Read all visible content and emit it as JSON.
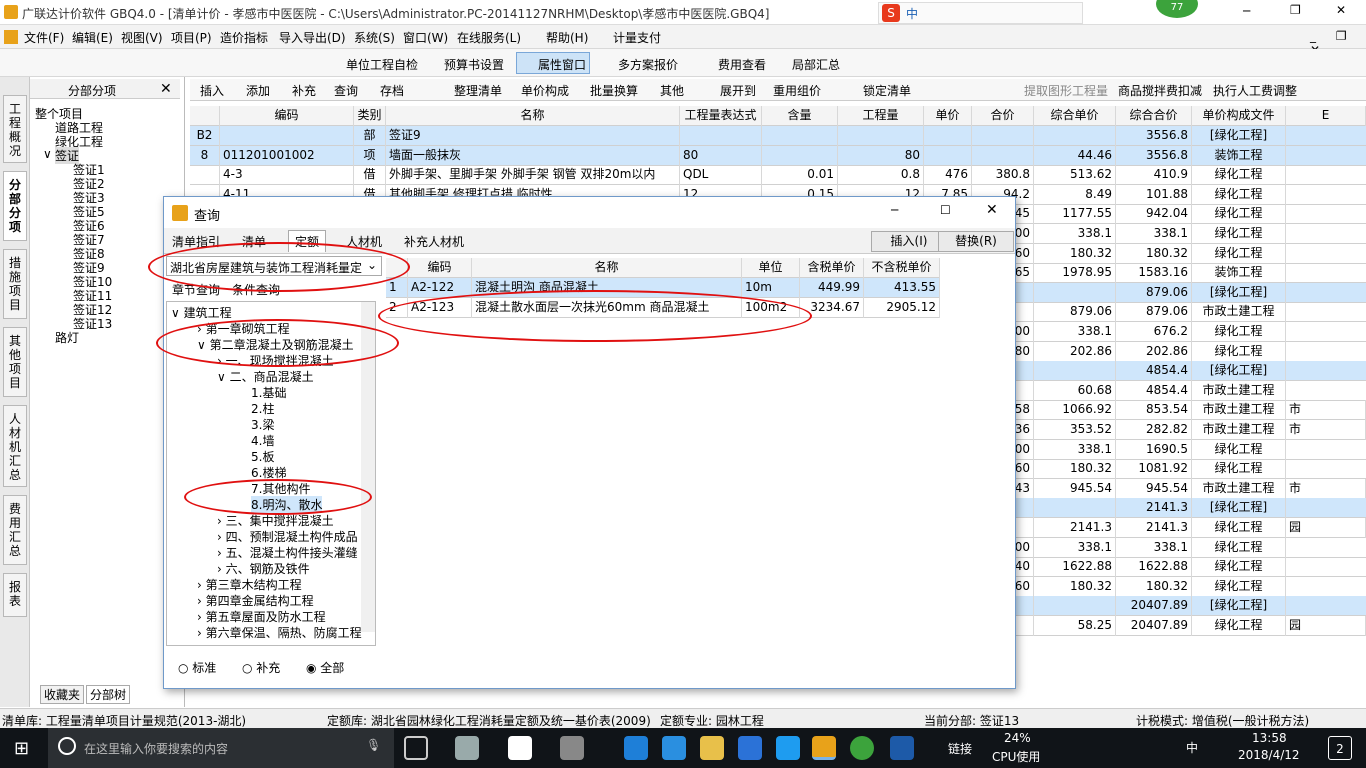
{
  "window": {
    "title": "广联达计价软件 GBQ4.0 - [清单计价 - 孝感市中医医院 - C:\\Users\\Administrator.PC-20141127NRHM\\Desktop\\孝感市中医医院.GBQ4]",
    "badge": "77",
    "ime": "中"
  },
  "menu": [
    "文件(F)",
    "编辑(E)",
    "视图(V)",
    "项目(P)",
    "造价指标",
    "导入导出(D)",
    "系统(S)",
    "窗口(W)",
    "在线服务(L)",
    "帮助(H)",
    "计量支付"
  ],
  "toolbar1": {
    "self_check": "单位工程自检",
    "budget_settings": "预算书设置",
    "properties": "属性窗口",
    "multi_plan": "多方案报价",
    "fee_view": "费用查看",
    "partial_summary": "局部汇总"
  },
  "left_tabs": [
    "工程概况",
    "分部分项",
    "措施项目",
    "其他项目",
    "人材机汇总",
    "费用汇总",
    "报表"
  ],
  "nav": {
    "header": "分部分项",
    "close": "✕",
    "items": [
      "整个项目",
      "道路工程",
      "绿化工程",
      "签证",
      "签证1",
      "签证2",
      "签证3",
      "签证5",
      "签证6",
      "签证7",
      "签证8",
      "签证9",
      "签证10",
      "签证11",
      "签证12",
      "签证13",
      "路灯"
    ],
    "bottom_tabs": [
      "收藏夹",
      "分部树"
    ]
  },
  "toolbar2": [
    "插入",
    "添加",
    "补充",
    "查询",
    "存档",
    "整理清单",
    "单价构成",
    "批量换算",
    "其他",
    "展开到",
    "重用组价",
    "锁定清单",
    "提取图形工程量",
    "商品搅拌费扣减",
    "执行人工费调整"
  ],
  "grid": {
    "headers": [
      "编码",
      "类别",
      "名称",
      "工程量表达式",
      "含量",
      "工程量",
      "单价",
      "合价",
      "综合单价",
      "综合合价",
      "单价构成文件",
      "E"
    ],
    "rows": [
      {
        "n": "B2",
        "code": "",
        "cat": "部",
        "name": "签证9",
        "expr": "",
        "qty_r": "",
        "qty": "",
        "price": "",
        "total": "",
        "cu": "",
        "ct": "3556.8",
        "file": "[绿化工程]"
      },
      {
        "n": "8",
        "code": "011201001002",
        "cat": "项",
        "name": "墙面一般抹灰",
        "expr": "80",
        "qty_r": "",
        "qty": "80",
        "price": "",
        "total": "",
        "cu": "44.46",
        "ct": "3556.8",
        "file": "装饰工程"
      },
      {
        "n": "",
        "code": "4-3",
        "cat": "借",
        "name": "外脚手架、里脚手架 外脚手架 钢管 双排20m以内",
        "expr": "QDL",
        "qty_r": "0.01",
        "qty": "0.8",
        "price": "476",
        "total": "380.8",
        "cu": "513.62",
        "ct": "410.9",
        "file": "绿化工程"
      },
      {
        "n": "",
        "code": "4-11",
        "cat": "借",
        "name": "其他脚手架 修理打点措 临时性",
        "expr": "12",
        "qty_r": "0.15",
        "qty": "12",
        "price": "7.85",
        "total": "94.2",
        "cu": "8.49",
        "ct": "101.88",
        "file": "绿化工程"
      },
      {
        "n": "",
        "code": "",
        "cat": "",
        "name": "",
        "expr": "",
        "qty_r": "",
        "qty": "",
        "price": "",
        "total": "66.45",
        "cu": "1177.55",
        "ct": "942.04",
        "file": "绿化工程"
      },
      {
        "n": "",
        "code": "",
        "cat": "",
        "name": "",
        "expr": "",
        "qty_r": "",
        "qty": "",
        "price": "",
        "total": "300",
        "cu": "338.1",
        "ct": "338.1",
        "file": "绿化工程"
      },
      {
        "n": "",
        "code": "",
        "cat": "",
        "name": "",
        "expr": "",
        "qty_r": "",
        "qty": "",
        "price": "",
        "total": "160",
        "cu": "180.32",
        "ct": "180.32",
        "file": "绿化工程"
      },
      {
        "n": "",
        "code": "",
        "cat": "",
        "name": "",
        "expr": "",
        "qty_r": "",
        "qty": "",
        "price": "",
        "total": "20.65",
        "cu": "1978.95",
        "ct": "1583.16",
        "file": "装饰工程"
      },
      {
        "n": "",
        "code": "",
        "cat": "",
        "name": "",
        "expr": "",
        "qty_r": "",
        "qty": "",
        "price": "",
        "total": "",
        "cu": "",
        "ct": "879.06",
        "file": "[绿化工程]"
      },
      {
        "n": "",
        "code": "",
        "cat": "",
        "name": "",
        "expr": "",
        "qty_r": "",
        "qty": "",
        "price": "",
        "total": "",
        "cu": "879.06",
        "ct": "879.06",
        "file": "市政土建工程"
      },
      {
        "n": "",
        "code": "",
        "cat": "",
        "name": "",
        "expr": "",
        "qty_r": "",
        "qty": "",
        "price": "",
        "total": "600",
        "cu": "338.1",
        "ct": "676.2",
        "file": "绿化工程"
      },
      {
        "n": "",
        "code": "",
        "cat": "",
        "name": "",
        "expr": "",
        "qty_r": "",
        "qty": "",
        "price": "",
        "total": "180",
        "cu": "202.86",
        "ct": "202.86",
        "file": "绿化工程"
      },
      {
        "n": "",
        "code": "",
        "cat": "",
        "name": "",
        "expr": "",
        "qty_r": "",
        "qty": "",
        "price": "",
        "total": "",
        "cu": "",
        "ct": "4854.4",
        "file": "[绿化工程]"
      },
      {
        "n": "",
        "code": "",
        "cat": "",
        "name": "",
        "expr": "",
        "qty_r": "",
        "qty": "",
        "price": "",
        "total": "",
        "cu": "60.68",
        "ct": "4854.4",
        "file": "市政土建工程"
      },
      {
        "n": "",
        "code": "",
        "cat": "",
        "name": "",
        "expr": "",
        "qty_r": "",
        "qty": "",
        "price": "",
        "total": "3.58",
        "cu": "1066.92",
        "ct": "853.54",
        "file": "市政土建工程",
        "e": "市"
      },
      {
        "n": "",
        "code": "",
        "cat": "",
        "name": "",
        "expr": "",
        "qty_r": "",
        "qty": "",
        "price": "",
        "total": "36.36",
        "cu": "353.52",
        "ct": "282.82",
        "file": "市政土建工程",
        "e": "市"
      },
      {
        "n": "",
        "code": "",
        "cat": "",
        "name": "",
        "expr": "",
        "qty_r": "",
        "qty": "",
        "price": "",
        "total": "1500",
        "cu": "338.1",
        "ct": "1690.5",
        "file": "绿化工程"
      },
      {
        "n": "",
        "code": "",
        "cat": "",
        "name": "",
        "expr": "",
        "qty_r": "",
        "qty": "",
        "price": "",
        "total": "960",
        "cu": "180.32",
        "ct": "1081.92",
        "file": "绿化工程"
      },
      {
        "n": "",
        "code": "",
        "cat": "",
        "name": "",
        "expr": "",
        "qty_r": "",
        "qty": "",
        "price": "",
        "total": "52.43",
        "cu": "945.54",
        "ct": "945.54",
        "file": "市政土建工程",
        "e": "市"
      },
      {
        "n": "",
        "code": "",
        "cat": "",
        "name": "",
        "expr": "",
        "qty_r": "",
        "qty": "",
        "price": "",
        "total": "",
        "cu": "",
        "ct": "2141.3",
        "file": "[绿化工程]"
      },
      {
        "n": "",
        "code": "",
        "cat": "",
        "name": "",
        "expr": "",
        "qty_r": "",
        "qty": "",
        "price": "",
        "total": "",
        "cu": "2141.3",
        "ct": "2141.3",
        "file": "绿化工程",
        "e": "园"
      },
      {
        "n": "",
        "code": "",
        "cat": "",
        "name": "",
        "expr": "",
        "qty_r": "",
        "qty": "",
        "price": "",
        "total": "300",
        "cu": "338.1",
        "ct": "338.1",
        "file": "绿化工程"
      },
      {
        "n": "",
        "code": "",
        "cat": "",
        "name": "",
        "expr": "",
        "qty_r": "",
        "qty": "",
        "price": "",
        "total": "1440",
        "cu": "1622.88",
        "ct": "1622.88",
        "file": "绿化工程"
      },
      {
        "n": "",
        "code": "",
        "cat": "",
        "name": "",
        "expr": "",
        "qty_r": "",
        "qty": "",
        "price": "",
        "total": "160",
        "cu": "180.32",
        "ct": "180.32",
        "file": "绿化工程"
      },
      {
        "n": "",
        "code": "",
        "cat": "",
        "name": "",
        "expr": "",
        "qty_r": "",
        "qty": "",
        "price": "",
        "total": "",
        "cu": "",
        "ct": "20407.89",
        "file": "[绿化工程]"
      },
      {
        "n": "",
        "code": "",
        "cat": "",
        "name": "",
        "expr": "",
        "qty_r": "",
        "qty": "",
        "price": "",
        "total": "",
        "cu": "58.25",
        "ct": "20407.89",
        "file": "绿化工程",
        "e": "园"
      }
    ]
  },
  "dialog": {
    "title": "查询",
    "min": "─",
    "max": "☐",
    "close": "✕",
    "tabs": [
      "清单指引",
      "清单",
      "定额",
      "人材机",
      "补充人材机"
    ],
    "insert": "插入(I)",
    "replace": "替换(R)",
    "library": "湖北省房屋建筑与装饰工程消耗量定",
    "subtabs": [
      "章节查询",
      "条件查询"
    ],
    "tree": [
      "建筑工程",
      "第一章砌筑工程",
      "第二章混凝土及钢筋混凝土",
      "一、现场搅拌混凝土",
      "二、商品混凝土",
      "1.基础",
      "2.柱",
      "3.梁",
      "4.墙",
      "5.板",
      "6.楼梯",
      "7.其他构件",
      "8.明沟、散水",
      "三、集中搅拌混凝土",
      "四、预制混凝土构件成品",
      "五、混凝土构件接头灌缝",
      "六、钢筋及铁件",
      "第三章木结构工程",
      "第四章金属结构工程",
      "第五章屋面及防水工程",
      "第六章保温、隔热、防腐工程"
    ],
    "table_headers": [
      "",
      "编码",
      "名称",
      "单位",
      "含税单价",
      "不含税单价"
    ],
    "rows": [
      {
        "n": "1",
        "code": "A2-122",
        "name": "混凝土明沟 商品混凝土",
        "unit": "10m",
        "tax": "449.99",
        "notax": "413.55"
      },
      {
        "n": "2",
        "code": "A2-123",
        "name": "混凝土散水面层一次抹光60mm 商品混凝土",
        "unit": "100m2",
        "tax": "3234.67",
        "notax": "2905.12"
      }
    ],
    "radios": [
      "标准",
      "补充",
      "全部"
    ]
  },
  "status": {
    "list_lib": "清单库: 工程量清单项目计量规范(2013-湖北)",
    "quota_lib": "定额库: 湖北省园林绿化工程消耗量定额及统一基价表(2009)",
    "major": "定额专业: 园林工程",
    "current": "当前分部: 签证13",
    "tax_mode": "计税模式: 增值税(一般计税方法)"
  },
  "taskbar": {
    "search": "在这里输入你要搜索的内容",
    "link": "链接",
    "cpu": "24%",
    "cpu_label": "CPU使用",
    "lang": "中",
    "time": "13:58",
    "date": "2018/4/12",
    "notif": "2"
  },
  "colors": {
    "accent": "#2b6cb5",
    "highlight": "#ff0000",
    "selected": "#cfe6fb"
  }
}
